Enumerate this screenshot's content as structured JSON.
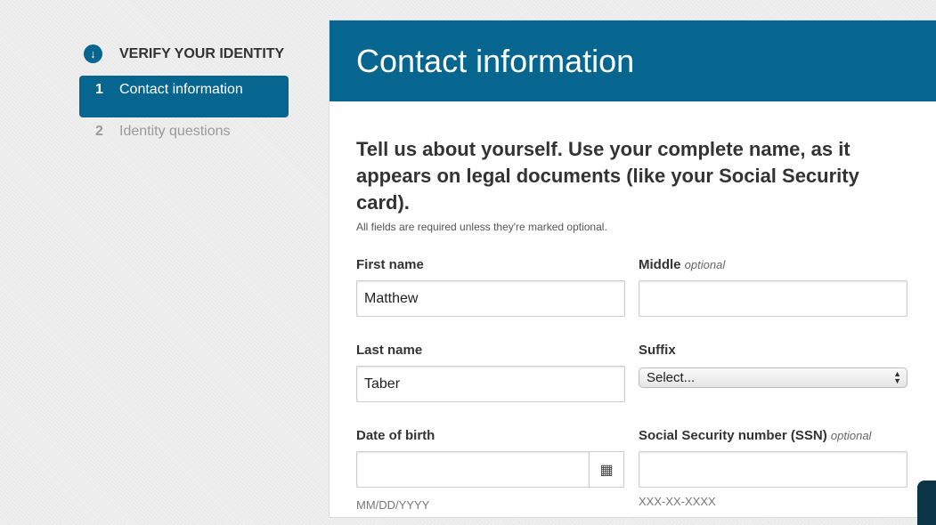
{
  "sidebar": {
    "heading": "VERIFY YOUR IDENTITY",
    "heading_icon": "arrow-down-circle-icon",
    "steps": [
      {
        "num": "1",
        "label": "Contact information",
        "active": true
      },
      {
        "num": "2",
        "label": "Identity questions",
        "active": false
      }
    ]
  },
  "panel": {
    "title": "Contact information",
    "intro": "Tell us about yourself. Use your complete name, as it appears on legal documents (like your Social Security card).",
    "required_note": "All fields are required unless they're marked optional.",
    "fields": {
      "first_name": {
        "label": "First name",
        "value": "Matthew"
      },
      "middle": {
        "label": "Middle",
        "optional": "optional",
        "value": ""
      },
      "last_name": {
        "label": "Last name",
        "value": "Taber"
      },
      "suffix": {
        "label": "Suffix",
        "value": "Select..."
      },
      "dob": {
        "label": "Date of birth",
        "value": "",
        "hint": "MM/DD/YYYY"
      },
      "ssn": {
        "label": "Social Security number (SSN)",
        "optional": "optional",
        "value": "",
        "hint": "XXX-XX-XXXX"
      }
    }
  },
  "colors": {
    "accent": "#07668f"
  }
}
